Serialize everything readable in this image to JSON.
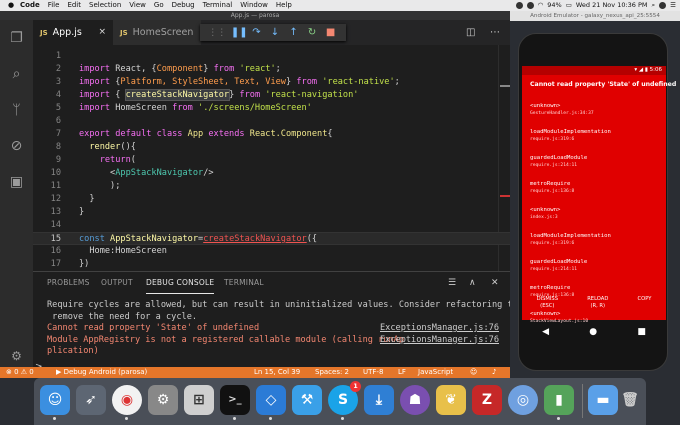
{
  "menubar": {
    "apple": "",
    "items": [
      "Code",
      "File",
      "Edit",
      "Selection",
      "View",
      "Go",
      "Debug",
      "Terminal",
      "Window",
      "Help"
    ],
    "battery": "94%",
    "datetime": "Wed 21 Nov  10:36 PM"
  },
  "vscode": {
    "window_title": "App.js — parosa",
    "tabs": [
      {
        "icon": "JS",
        "label": "App.js",
        "close": "×"
      },
      {
        "icon": "JS",
        "label": "HomeScreen"
      }
    ],
    "editor_lines": [
      {
        "num": "1",
        "segments": []
      },
      {
        "num": "2",
        "segments": [
          [
            "kw",
            "import "
          ],
          [
            "plain",
            "React, {"
          ],
          [
            "orange",
            "Component"
          ],
          [
            "plain",
            "} "
          ],
          [
            "kw",
            "from "
          ],
          [
            "str",
            "'react'"
          ],
          [
            "plain",
            ";"
          ]
        ]
      },
      {
        "num": "3",
        "segments": [
          [
            "kw",
            "import "
          ],
          [
            "plain",
            "{"
          ],
          [
            "orange",
            "Platform, StyleSheet, Text, View"
          ],
          [
            "plain",
            "} "
          ],
          [
            "kw",
            "from "
          ],
          [
            "str",
            "'react-native'"
          ],
          [
            "plain",
            ";"
          ]
        ]
      },
      {
        "num": "4",
        "segments": [
          [
            "kw",
            "import "
          ],
          [
            "plain",
            "{ "
          ],
          [
            "hl",
            "createStackNavigator"
          ],
          [
            "plain",
            "} "
          ],
          [
            "kw",
            "from "
          ],
          [
            "str",
            "'react-navigation'"
          ]
        ]
      },
      {
        "num": "5",
        "segments": [
          [
            "kw",
            "import "
          ],
          [
            "plain",
            "HomeScreen "
          ],
          [
            "kw",
            "from "
          ],
          [
            "str",
            "'./screens/HomeScreen'"
          ]
        ]
      },
      {
        "num": "6",
        "segments": []
      },
      {
        "num": "7",
        "segments": [
          [
            "kw",
            "export default class "
          ],
          [
            "cls",
            "App "
          ],
          [
            "kw",
            "extends "
          ],
          [
            "cls",
            "React.Component"
          ],
          [
            "plain",
            "{"
          ]
        ]
      },
      {
        "num": "8",
        "segments": [
          [
            "plain",
            "  "
          ],
          [
            "ident",
            "render"
          ],
          [
            "plain",
            "(){"
          ]
        ]
      },
      {
        "num": "9",
        "segments": [
          [
            "plain",
            "    "
          ],
          [
            "kw",
            "return"
          ],
          [
            "plain",
            "("
          ]
        ]
      },
      {
        "num": "10",
        "segments": [
          [
            "plain",
            "      <"
          ],
          [
            "tag",
            "AppStackNavigator"
          ],
          [
            "plain",
            "/>"
          ]
        ]
      },
      {
        "num": "11",
        "segments": [
          [
            "plain",
            "      );"
          ]
        ]
      },
      {
        "num": "12",
        "segments": [
          [
            "plain",
            "  }"
          ]
        ]
      },
      {
        "num": "13",
        "segments": [
          [
            "plain",
            "}"
          ]
        ]
      },
      {
        "num": "14",
        "segments": []
      },
      {
        "num": "15",
        "segments": [
          [
            "kw2",
            "const "
          ],
          [
            "ident",
            "AppStackNavigator"
          ],
          [
            "plain",
            "="
          ],
          [
            "redul",
            "createStackNavigator"
          ],
          [
            "plain",
            "({"
          ]
        ]
      },
      {
        "num": "16",
        "segments": [
          [
            "plain",
            "  Home:HomeScreen"
          ]
        ]
      },
      {
        "num": "17",
        "segments": [
          [
            "plain",
            "})"
          ]
        ]
      }
    ],
    "panel_tabs": [
      "PROBLEMS",
      "OUTPUT",
      "DEBUG CONSOLE",
      "TERMINAL"
    ],
    "console": [
      {
        "type": "w",
        "text": "Require cycles are allowed, but can result in uninitialized values. Consider refactoring to",
        "src": ""
      },
      {
        "type": "w",
        "text": " remove the need for a cycle.",
        "src": ""
      },
      {
        "type": "e",
        "text": "Cannot read property 'State' of undefined",
        "src": "ExceptionsManager.js:76"
      },
      {
        "type": "e",
        "text": "Module AppRegistry is not a registered callable module (calling runAp",
        "src": "ExceptionsManager.js:76"
      },
      {
        "type": "e",
        "text": "plication)",
        "src": ""
      }
    ],
    "prompt": ">",
    "status": {
      "problems": "⊗ 0  ⚠ 0",
      "debug": "▶ Debug Android (parosa)",
      "position": "Ln 15, Col 39",
      "spaces": "Spaces: 2",
      "encoding": "UTF-8",
      "eol": "LF",
      "language": "JavaScript"
    }
  },
  "emulator": {
    "title": "Android Emulator - galaxy_nexus_api_25:5554",
    "time": "5:06",
    "error_title": "Cannot read property 'State' of undefined",
    "frames": [
      {
        "fn": "<unknown>",
        "file": "GestureHandler.js:34:37"
      },
      {
        "fn": "loadModuleImplementation",
        "file": "require.js:319:6"
      },
      {
        "fn": "guardedLoadModule",
        "file": "require.js:214:11"
      },
      {
        "fn": "metroRequire",
        "file": "require.js:136:8"
      },
      {
        "fn": "<unknown>",
        "file": "index.js:3"
      },
      {
        "fn": "loadModuleImplementation",
        "file": "require.js:319:6"
      },
      {
        "fn": "guardedLoadModule",
        "file": "require.js:214:11"
      },
      {
        "fn": "metroRequire",
        "file": "require.js:136:8"
      },
      {
        "fn": "<unknown>",
        "file": "StackViewLayout.js:10"
      }
    ],
    "buttons": [
      {
        "label": "DISMISS",
        "sub": "(ESC)"
      },
      {
        "label": "RELOAD",
        "sub": "(R, R)"
      },
      {
        "label": "COPY",
        "sub": ""
      }
    ]
  },
  "dock": {
    "skype_badge": "1"
  },
  "colors": {
    "status_bar": "#e5762a",
    "redbox": "#e00000",
    "editor_bg": "#1e1e1e"
  }
}
